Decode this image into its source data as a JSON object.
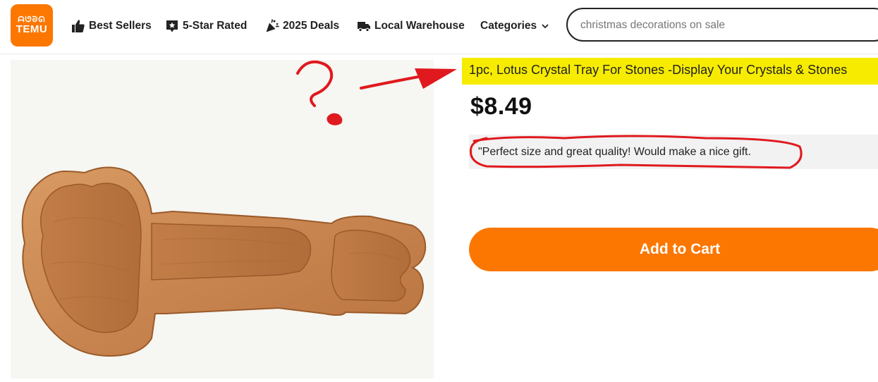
{
  "header": {
    "logo": {
      "glyphs": "ᗩᘎᘐᘏ",
      "word": "TEMU",
      "color": "#fb7701"
    },
    "nav": [
      {
        "label": "Best Sellers",
        "icon": "thumbs-up-icon"
      },
      {
        "label": "5-Star Rated",
        "icon": "star-badge-icon"
      },
      {
        "label": "2025 Deals",
        "icon": "party-popper-icon"
      },
      {
        "label": "Local Warehouse",
        "icon": "delivery-truck-icon"
      },
      {
        "label": "Categories",
        "icon": "chevron-down-icon"
      }
    ],
    "search": {
      "placeholder": "christmas decorations on sale"
    }
  },
  "product": {
    "image_description": "wooden crystal tray",
    "title": "1pc, Lotus Crystal Tray For Stones -Display Your Crystals & Stones",
    "price": "$8.49",
    "review": "\"Perfect size and great quality! Would make a nice gift.",
    "add_to_cart_label": "Add to Cart"
  },
  "annotations": {
    "question_mark": "?",
    "color": "#e0191e",
    "title_highlight_color": "#f7ec00"
  },
  "colors": {
    "brand": "#fb7701",
    "text": "#222222"
  }
}
